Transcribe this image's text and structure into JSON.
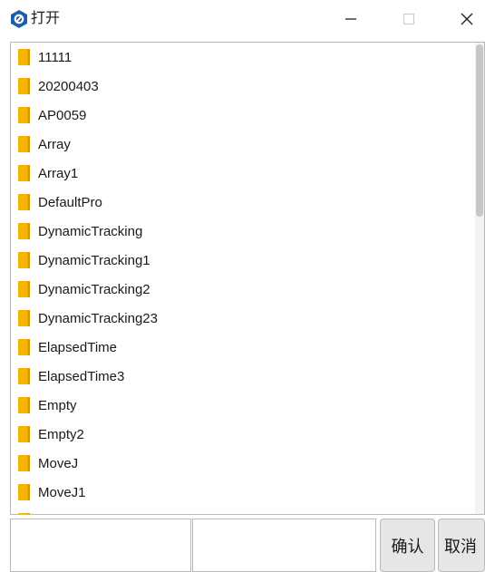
{
  "window": {
    "title": "打开",
    "accent": "#1f5fa8"
  },
  "file_list": {
    "items": [
      {
        "name": "11111",
        "icon": "folder-icon"
      },
      {
        "name": "20200403",
        "icon": "folder-icon"
      },
      {
        "name": "AP0059",
        "icon": "folder-icon"
      },
      {
        "name": "Array",
        "icon": "folder-icon"
      },
      {
        "name": "Array1",
        "icon": "folder-icon"
      },
      {
        "name": "DefaultPro",
        "icon": "folder-icon"
      },
      {
        "name": "DynamicTracking",
        "icon": "folder-icon"
      },
      {
        "name": "DynamicTracking1",
        "icon": "folder-icon"
      },
      {
        "name": "DynamicTracking2",
        "icon": "folder-icon"
      },
      {
        "name": "DynamicTracking23",
        "icon": "folder-icon"
      },
      {
        "name": "ElapsedTime",
        "icon": "folder-icon"
      },
      {
        "name": "ElapsedTime3",
        "icon": "folder-icon"
      },
      {
        "name": "Empty",
        "icon": "folder-icon"
      },
      {
        "name": "Empty2",
        "icon": "folder-icon"
      },
      {
        "name": "MoveJ",
        "icon": "folder-icon"
      },
      {
        "name": "MoveJ1",
        "icon": "folder-icon"
      },
      {
        "name": "",
        "icon": "folder-icon"
      }
    ],
    "folder_color": "#f5b400"
  },
  "bottom_bar": {
    "filename_value": "",
    "filetype_value": "",
    "confirm_label": "确认",
    "cancel_label": "取消"
  }
}
